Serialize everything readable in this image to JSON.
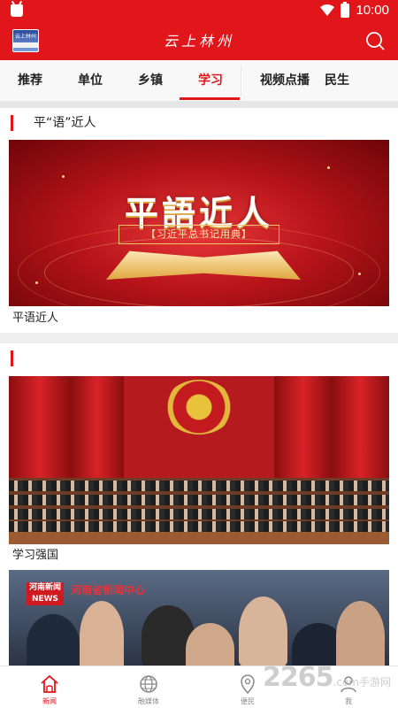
{
  "status": {
    "time": "10:00"
  },
  "header": {
    "title": "云上林州",
    "logo_text": "云上林州"
  },
  "tabs": [
    {
      "label": "推荐"
    },
    {
      "label": "单位"
    },
    {
      "label": "乡镇"
    },
    {
      "label": "学习",
      "active": true
    },
    {
      "label": "视频点播"
    },
    {
      "label": "民生"
    }
  ],
  "sections": [
    {
      "title": "平“语”近人",
      "cards": [
        {
          "caption": "平语近人",
          "image_text": {
            "headline": "平語近人",
            "subline": "【习近平总书记用典】"
          }
        }
      ]
    },
    {
      "title": "",
      "cards": [
        {
          "caption": "学习强国"
        },
        {
          "image_text": {
            "badge_top": "河南新闻",
            "badge_bottom": "NEWS",
            "overlay": "河南省新闻中心"
          }
        }
      ]
    }
  ],
  "bottom_nav": [
    {
      "label": "新闻",
      "icon": "home-icon",
      "active": true
    },
    {
      "label": "融媒体",
      "icon": "globe-icon"
    },
    {
      "label": "便民",
      "icon": "location-pin-icon"
    },
    {
      "label": "我",
      "icon": "user-icon"
    }
  ],
  "watermark": {
    "number": "2265",
    "suffix": ".com",
    "site": "手游网"
  },
  "colors": {
    "brand": "#e0161b",
    "tab_bg": "#f8f8f8",
    "page_bg": "#efefef"
  }
}
